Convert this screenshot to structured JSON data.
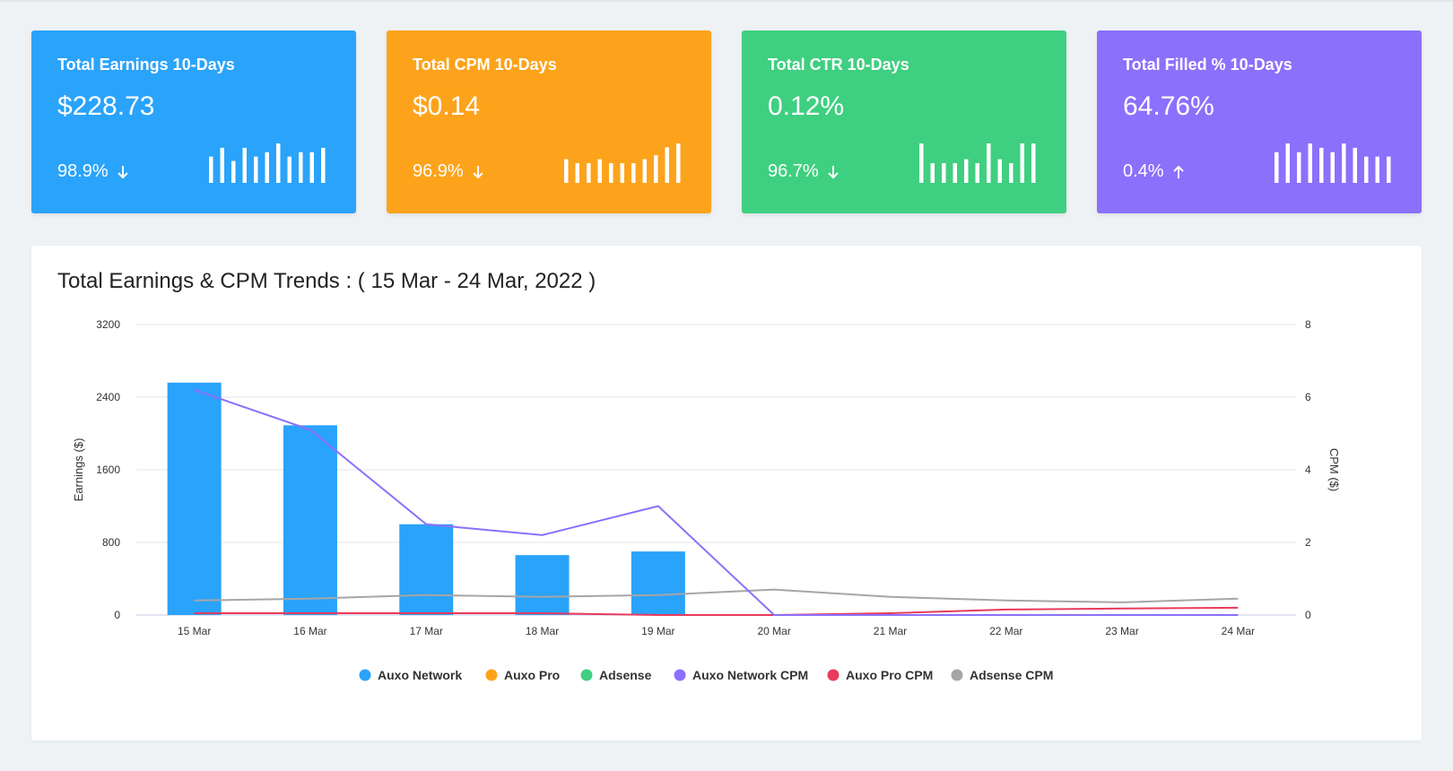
{
  "cards": [
    {
      "title": "Total Earnings 10-Days",
      "value": "$228.73",
      "change": "98.9%",
      "direction": "down",
      "color": "#2aa3fa",
      "spark": [
        6,
        8,
        5,
        8,
        6,
        7,
        9,
        6,
        7,
        7,
        8
      ]
    },
    {
      "title": "Total CPM 10-Days",
      "value": "$0.14",
      "change": "96.9%",
      "direction": "down",
      "color": "#fda31b",
      "spark": [
        6,
        5,
        5,
        6,
        5,
        5,
        5,
        6,
        7,
        9,
        10
      ]
    },
    {
      "title": "Total CTR 10-Days",
      "value": "0.12%",
      "change": "96.7%",
      "direction": "down",
      "color": "#3fcf80",
      "spark": [
        10,
        5,
        5,
        5,
        6,
        5,
        10,
        6,
        5,
        10,
        10
      ]
    },
    {
      "title": "Total Filled % 10-Days",
      "value": "64.76%",
      "change": "0.4%",
      "direction": "up",
      "color": "#8b70fb",
      "spark": [
        7,
        9,
        7,
        9,
        8,
        7,
        9,
        8,
        6,
        6,
        6
      ]
    }
  ],
  "panel": {
    "title": "Total Earnings & CPM Trends : ( 15 Mar - 24 Mar, 2022 )"
  },
  "chart_data": {
    "type": "bar",
    "title": "Total Earnings & CPM Trends : ( 15 Mar - 24 Mar, 2022 )",
    "categories": [
      "15 Mar",
      "16 Mar",
      "17 Mar",
      "18 Mar",
      "19 Mar",
      "20 Mar",
      "21 Mar",
      "22 Mar",
      "23 Mar",
      "24 Mar"
    ],
    "ylabel": "Earnings ($)",
    "y2label": "CPM ($)",
    "ylim": [
      0,
      3200
    ],
    "yticks": [
      0,
      800,
      1600,
      2400,
      3200
    ],
    "y2lim": [
      0,
      8
    ],
    "y2ticks": [
      0,
      2,
      4,
      6,
      8
    ],
    "grid": true,
    "legend_position": "bottom",
    "series": [
      {
        "name": "Auxo Network",
        "type": "bar",
        "axis": "left",
        "color": "#2aa3fa",
        "values": [
          2560,
          2090,
          1000,
          660,
          700,
          0,
          0,
          0,
          0,
          0
        ]
      },
      {
        "name": "Auxo Pro",
        "type": "bar",
        "axis": "left",
        "color": "#fda31b",
        "values": [
          0,
          0,
          0,
          0,
          0,
          0,
          0,
          0,
          0,
          0
        ]
      },
      {
        "name": "Adsense",
        "type": "bar",
        "axis": "left",
        "color": "#3fcf80",
        "values": [
          0,
          0,
          0,
          0,
          0,
          0,
          0,
          0,
          0,
          0
        ]
      },
      {
        "name": "Auxo Network CPM",
        "type": "line",
        "axis": "right",
        "color": "#8b70fb",
        "values": [
          6.2,
          5.1,
          2.5,
          2.2,
          3.0,
          0.0,
          0.0,
          0.0,
          0.0,
          0.0
        ]
      },
      {
        "name": "Auxo Pro CPM",
        "type": "line",
        "axis": "right",
        "color": "#e83a5c",
        "values": [
          0.05,
          0.05,
          0.05,
          0.05,
          0.0,
          0.0,
          0.05,
          0.15,
          0.18,
          0.2
        ]
      },
      {
        "name": "Adsense CPM",
        "type": "line",
        "axis": "right",
        "color": "#a6a6a6",
        "values": [
          0.4,
          0.45,
          0.55,
          0.5,
          0.55,
          0.7,
          0.5,
          0.4,
          0.35,
          0.45
        ]
      }
    ]
  }
}
